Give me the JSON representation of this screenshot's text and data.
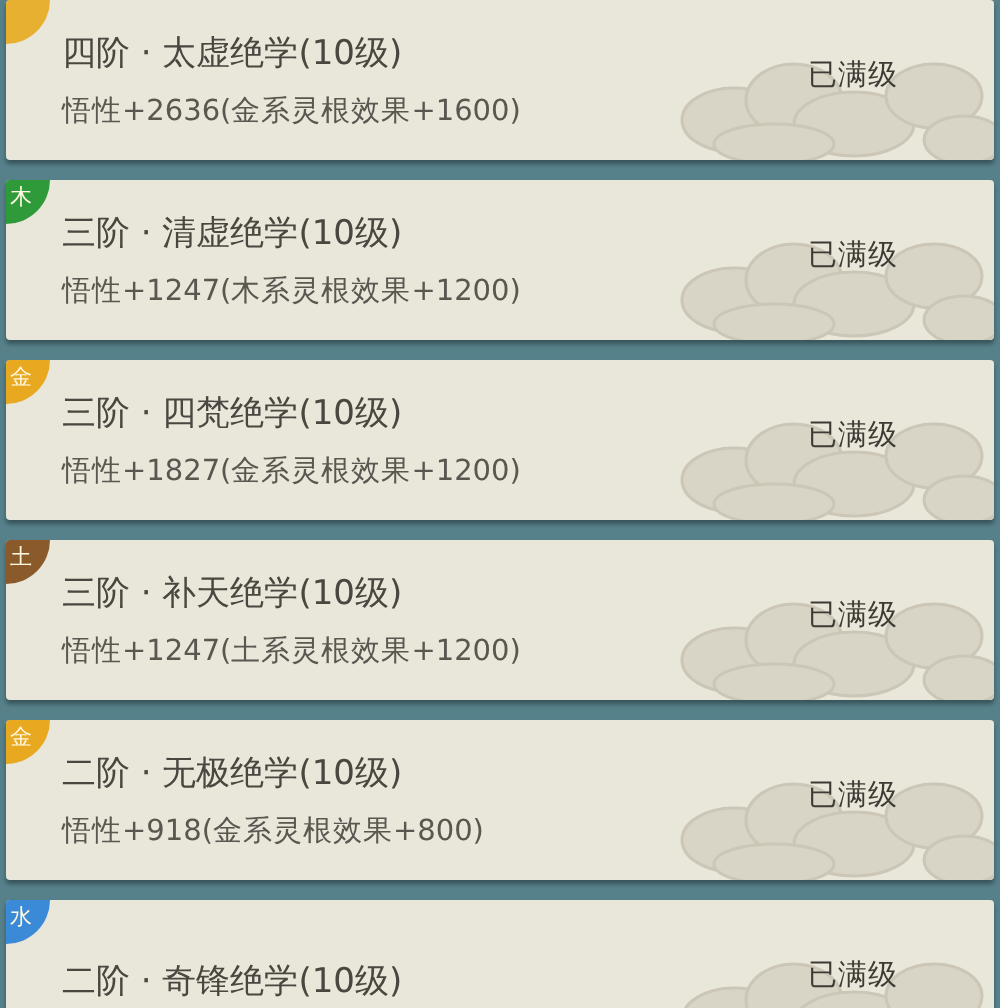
{
  "skills": [
    {
      "badge": {
        "color": "#e8b030"
      },
      "title": "四阶 · 太虚绝学(10级)",
      "effect": "悟性+2636(金系灵根效果+1600)",
      "status": "已满级"
    },
    {
      "badge": {
        "label": "木",
        "color": "#2f9a3a"
      },
      "title": "三阶 · 清虚绝学(10级)",
      "effect": "悟性+1247(木系灵根效果+1200)",
      "status": "已满级"
    },
    {
      "badge": {
        "label": "金",
        "color": "#e8a820"
      },
      "title": "三阶 · 四梵绝学(10级)",
      "effect": "悟性+1827(金系灵根效果+1200)",
      "status": "已满级"
    },
    {
      "badge": {
        "label": "土",
        "color": "#8a5a2a"
      },
      "title": "三阶 · 补天绝学(10级)",
      "effect": "悟性+1247(土系灵根效果+1200)",
      "status": "已满级"
    },
    {
      "badge": {
        "label": "金",
        "color": "#e8a820"
      },
      "title": "二阶 · 无极绝学(10级)",
      "effect": "悟性+918(金系灵根效果+800)",
      "status": "已满级"
    },
    {
      "badge": {
        "label": "水",
        "color": "#3a8ad8"
      },
      "title": "二阶 · 奇锋绝学(10级)",
      "status": "已满级"
    }
  ]
}
